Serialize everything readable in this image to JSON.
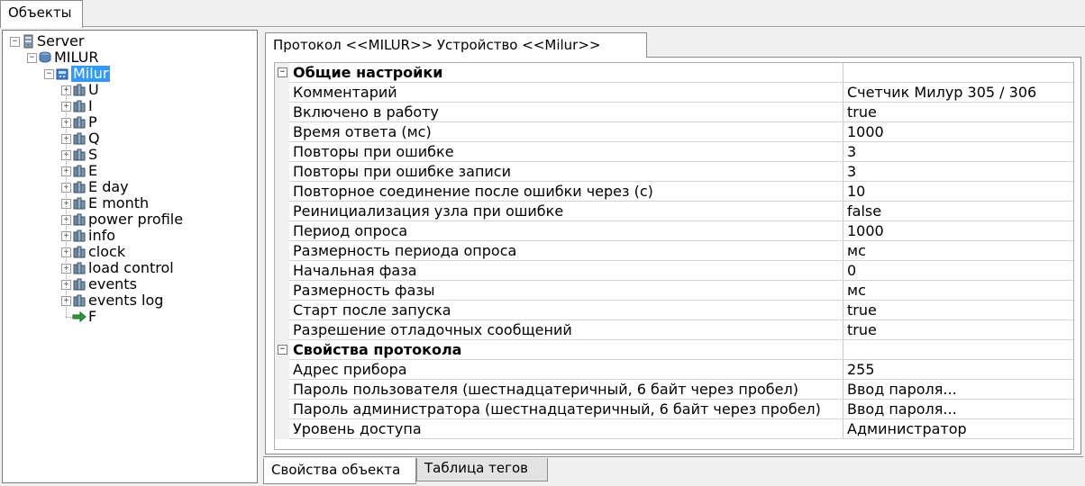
{
  "top_tab": {
    "label": "Объекты"
  },
  "tree": [
    {
      "label": "Server",
      "icon": "server-icon",
      "expanded": true
    },
    {
      "label": "MILUR",
      "icon": "channel-icon",
      "expanded": true
    },
    {
      "label": "Milur",
      "icon": "device-icon",
      "expanded": true,
      "selected": true
    },
    {
      "label": "U",
      "icon": "group-icon"
    },
    {
      "label": "I",
      "icon": "group-icon"
    },
    {
      "label": "P",
      "icon": "group-icon"
    },
    {
      "label": "Q",
      "icon": "group-icon"
    },
    {
      "label": "S",
      "icon": "group-icon"
    },
    {
      "label": "E",
      "icon": "group-icon"
    },
    {
      "label": "E  day",
      "icon": "group-icon"
    },
    {
      "label": "E  month",
      "icon": "group-icon"
    },
    {
      "label": "power  profile",
      "icon": "group-icon"
    },
    {
      "label": "info",
      "icon": "group-icon"
    },
    {
      "label": "clock",
      "icon": "group-icon"
    },
    {
      "label": "load  control",
      "icon": "group-icon"
    },
    {
      "label": "events",
      "icon": "group-icon"
    },
    {
      "label": "events  log",
      "icon": "group-icon"
    },
    {
      "label": "F",
      "icon": "arrow-tag-icon"
    }
  ],
  "protocol_tab": {
    "label": "Протокол <<MILUR>> Устройство <<Milur>>"
  },
  "properties": [
    {
      "category": true,
      "name": "Общие настройки",
      "value": ""
    },
    {
      "name": "Комментарий",
      "value": "Счетчик Милур 305 / 306"
    },
    {
      "name": "Включено в работу",
      "value": "true"
    },
    {
      "name": "Время ответа (мс)",
      "value": "1000"
    },
    {
      "name": "Повторы при ошибке",
      "value": "3"
    },
    {
      "name": "Повторы при ошибке записи",
      "value": "3"
    },
    {
      "name": "Повторное соединение после ошибки через (с)",
      "value": "10"
    },
    {
      "name": "Реинициализация узла при ошибке",
      "value": "false"
    },
    {
      "name": "Период опроса",
      "value": "1000"
    },
    {
      "name": "Размерность периода опроса",
      "value": "мс"
    },
    {
      "name": "Начальная фаза",
      "value": "0"
    },
    {
      "name": "Размерность фазы",
      "value": "мс"
    },
    {
      "name": "Старт после запуска",
      "value": "true"
    },
    {
      "name": "Разрешение отладочных сообщений",
      "value": "true"
    },
    {
      "category": true,
      "name": "Свойства протокола",
      "value": ""
    },
    {
      "name": "Адрес прибора",
      "value": "255"
    },
    {
      "name": "Пароль пользователя (шестнадцатеричный, 6 байт через пробел)",
      "value": "Ввод пароля..."
    },
    {
      "name": "Пароль администратора (шестнадцатеричный, 6 байт через пробел)",
      "value": "Ввод пароля..."
    },
    {
      "name": "Уровень доступа",
      "value": "Администратор"
    }
  ],
  "bottom_tabs": {
    "active": "Свойства объекта",
    "inactive": "Таблица тегов"
  },
  "colors": {
    "selection": "#3399ff",
    "background": "#f0f0f0",
    "border": "#8c8c8c"
  }
}
